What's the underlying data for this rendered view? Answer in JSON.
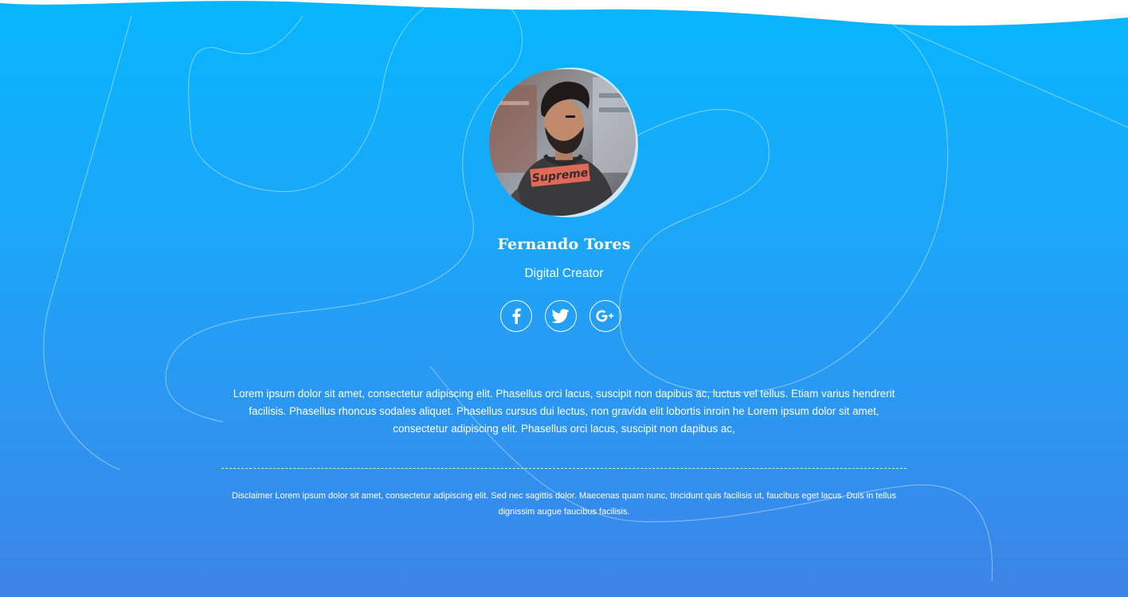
{
  "colors": {
    "gradient_top": "#08b6fd",
    "gradient_bottom": "#3d83e8",
    "avatar_blob": "#cfe9fb",
    "text": "#ffffff"
  },
  "profile": {
    "name": "Fernando Tores",
    "role": "Digital Creator",
    "photo_shirt_text": "Supreme"
  },
  "socials": [
    {
      "network": "facebook",
      "icon": "facebook-icon",
      "label": "f"
    },
    {
      "network": "twitter",
      "icon": "twitter-icon",
      "label": ""
    },
    {
      "network": "google-plus",
      "icon": "google-plus-icon",
      "label": "G+"
    }
  ],
  "bio": "Lorem ipsum dolor sit amet, consectetur adipiscing elit. Phasellus orci lacus, suscipit non dapibus ac, luctus vel tellus. Etiam varius hendrerit facilisis. Phasellus rhoncus sodales aliquet. Phasellus cursus dui lectus, non gravida elit lobortis inroin he Lorem ipsum dolor sit amet, consectetur adipiscing elit. Phasellus orci lacus, suscipit non dapibus ac,",
  "disclaimer": "Disclaimer Lorem ipsum dolor sit amet, consectetur adipiscing elit. Sed nec sagittis dolor. Maecenas quam nunc, tincidunt quis facilisis ut, faucibus eget lacus. Duis in tellus dignissim augue faucibus facilisis."
}
